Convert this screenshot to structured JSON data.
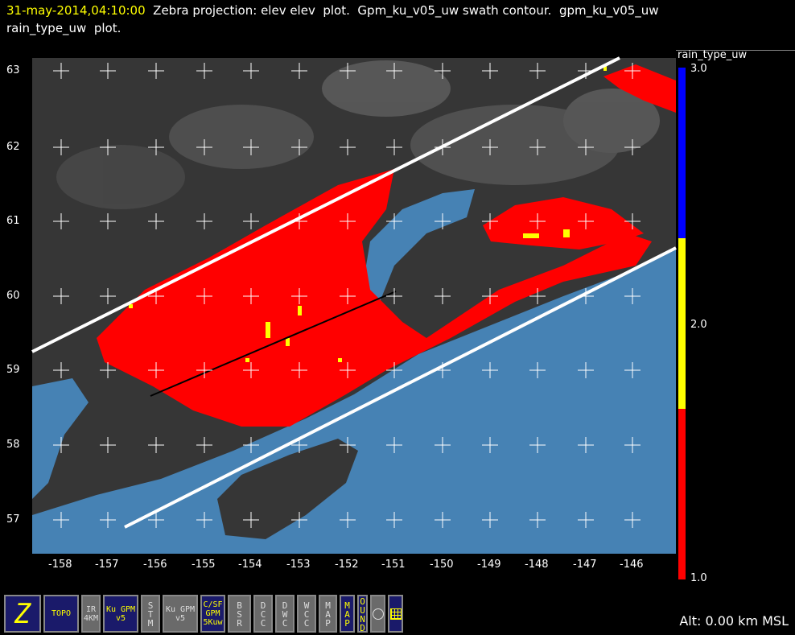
{
  "header": {
    "timestamp": "31-may-2014,04:10:00",
    "line1": "  Zebra projection: elev elev  plot.  Gpm_ku_v05_uw swath contour.  gpm_ku_v05_uw",
    "line2": "rain_type_uw  plot."
  },
  "map": {
    "lat_ticks": [
      "63",
      "62",
      "61",
      "60",
      "59",
      "58",
      "57"
    ],
    "lon_ticks": [
      "-158",
      "-157",
      "-156",
      "-155",
      "-154",
      "-153",
      "-152",
      "-151",
      "-150",
      "-149",
      "-148",
      "-147",
      "-146"
    ],
    "colors": {
      "land": "#363636",
      "ocean": "#4682b4",
      "rain_stratiform": "#ff0000",
      "rain_convective": "#ffff00",
      "swath": "#ffffff",
      "track": "#000000"
    }
  },
  "legend": {
    "title": "rain_type_uw",
    "max_label": "3.0",
    "mid_label": "2.0",
    "min_label": "1.0",
    "colors": [
      "#0000ff",
      "#ffff00",
      "#ff0000"
    ]
  },
  "status": {
    "altitude": "Alt: 0.00 km MSL"
  },
  "toolbar": [
    {
      "id": "zebra",
      "label": "Z",
      "style": "navy"
    },
    {
      "id": "topo",
      "label": "TOPO",
      "style": "navy"
    },
    {
      "id": "ir",
      "label": "IR 4KM",
      "style": "gray"
    },
    {
      "id": "ku-gpm",
      "label": "Ku GPM v5",
      "style": "navy"
    },
    {
      "id": "stm",
      "label": "STM",
      "style": "gray"
    },
    {
      "id": "ku-gpm-gray",
      "label": "Ku GPM v5",
      "style": "gray"
    },
    {
      "id": "csf",
      "label": "C/SF GPM 5Kuw",
      "style": "navy"
    },
    {
      "id": "bsr",
      "label": "BSR",
      "style": "gray"
    },
    {
      "id": "dcc",
      "label": "DCC",
      "style": "gray"
    },
    {
      "id": "dwc",
      "label": "DWC",
      "style": "gray"
    },
    {
      "id": "wcc",
      "label": "WCC",
      "style": "gray"
    },
    {
      "id": "map-gray",
      "label": "MAP",
      "style": "gray"
    },
    {
      "id": "map-navy",
      "label": "MAP",
      "style": "navy"
    },
    {
      "id": "bounds",
      "label": "BOUNDS",
      "style": "navy"
    },
    {
      "id": "circle",
      "label": "",
      "style": "gray"
    },
    {
      "id": "grid",
      "label": "",
      "style": "navy"
    }
  ]
}
